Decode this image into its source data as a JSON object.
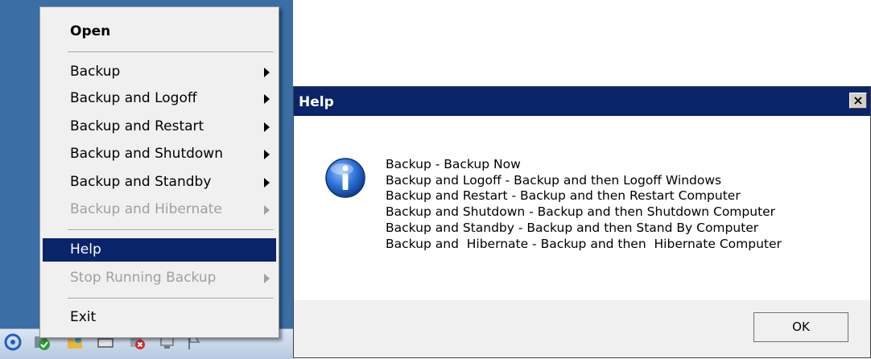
{
  "context_menu": {
    "items": [
      {
        "label": "Open",
        "style": "bold"
      },
      {
        "label": "Backup",
        "submenu": true
      },
      {
        "label": "Backup and Logoff",
        "submenu": true
      },
      {
        "label": "Backup and Restart",
        "submenu": true
      },
      {
        "label": "Backup and Shutdown",
        "submenu": true
      },
      {
        "label": "Backup and Standby",
        "submenu": true
      },
      {
        "label": "Backup and Hibernate",
        "submenu": true,
        "disabled": true
      },
      {
        "label": "Help",
        "highlighted": true
      },
      {
        "label": "Stop Running Backup",
        "submenu": true,
        "disabled": true
      },
      {
        "label": "Exit"
      }
    ]
  },
  "taskbar": {
    "tray_icons": [
      "network-icon",
      "shield-icon",
      "folder-icon",
      "window-icon",
      "error-icon",
      "computer-icon",
      "flag-icon"
    ]
  },
  "dialog": {
    "title": "Help",
    "close_label": "×",
    "icon": "info-icon",
    "lines": [
      "Backup - Backup Now",
      "Backup and Logoff - Backup and then Logoff Windows",
      "Backup and Restart - Backup and then Restart Computer",
      "Backup and Shutdown - Backup and then Shutdown Computer",
      "Backup and Standby - Backup and then Stand By Computer",
      "Backup and  Hibernate - Backup and then  Hibernate Computer"
    ],
    "ok_label": "OK"
  },
  "colors": {
    "desktop": "#3a6ea5",
    "highlight": "#0a246a",
    "titlebar": "#0a246a",
    "disabled_text": "#a0a0a0"
  }
}
